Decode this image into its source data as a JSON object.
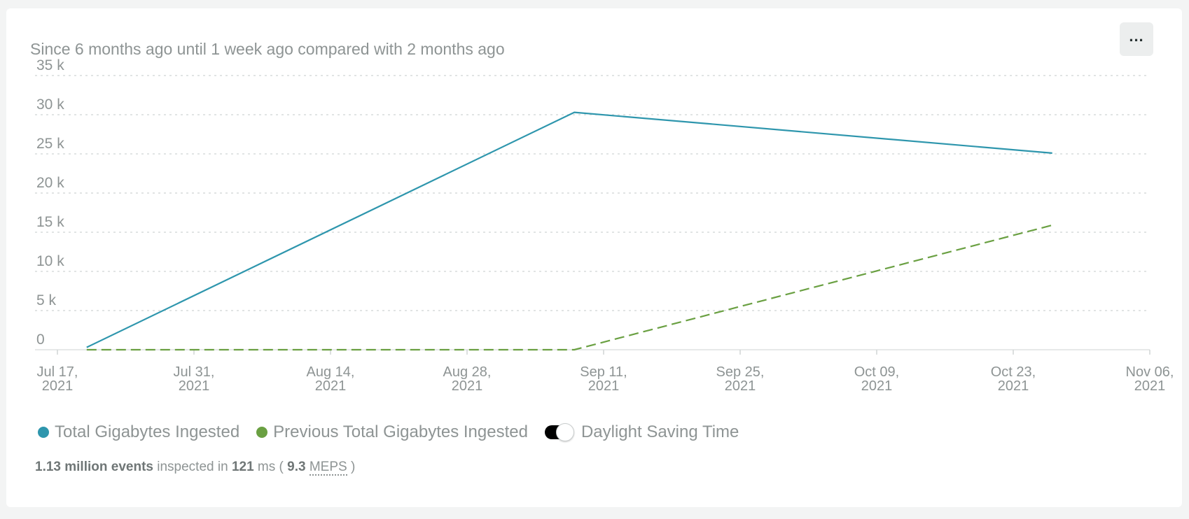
{
  "header": {
    "subtitle": "Since 6 months ago until 1 week ago compared with 2 months ago",
    "menu_label": "..."
  },
  "chart_data": {
    "type": "line",
    "ylim": [
      0,
      35000
    ],
    "y_ticks": [
      {
        "value": 0,
        "label": "0"
      },
      {
        "value": 5000,
        "label": "5 k"
      },
      {
        "value": 10000,
        "label": "10 k"
      },
      {
        "value": 15000,
        "label": "15 k"
      },
      {
        "value": 20000,
        "label": "20 k"
      },
      {
        "value": 25000,
        "label": "25 k"
      },
      {
        "value": 30000,
        "label": "30 k"
      },
      {
        "value": 35000,
        "label": "35 k"
      }
    ],
    "xlim": [
      "2021-07-17",
      "2021-11-06"
    ],
    "x_ticks": [
      {
        "date": "2021-07-17",
        "line1": "Jul 17,",
        "line2": "2021"
      },
      {
        "date": "2021-07-31",
        "line1": "Jul 31,",
        "line2": "2021"
      },
      {
        "date": "2021-08-14",
        "line1": "Aug 14,",
        "line2": "2021"
      },
      {
        "date": "2021-08-28",
        "line1": "Aug 28,",
        "line2": "2021"
      },
      {
        "date": "2021-09-11",
        "line1": "Sep 11,",
        "line2": "2021"
      },
      {
        "date": "2021-09-25",
        "line1": "Sep 25,",
        "line2": "2021"
      },
      {
        "date": "2021-10-09",
        "line1": "Oct 09,",
        "line2": "2021"
      },
      {
        "date": "2021-10-23",
        "line1": "Oct 23,",
        "line2": "2021"
      },
      {
        "date": "2021-11-06",
        "line1": "Nov 06,",
        "line2": "2021"
      }
    ],
    "grid": true,
    "legend_position": "bottom-left",
    "series": [
      {
        "name": "Total Gigabytes Ingested",
        "color": "#2e96ad",
        "style": "solid",
        "points": [
          {
            "date": "2021-07-20",
            "y": 300
          },
          {
            "date": "2021-09-08",
            "y": 30300
          },
          {
            "date": "2021-10-27",
            "y": 25100
          }
        ]
      },
      {
        "name": "Previous Total Gigabytes Ingested",
        "color": "#6aa042",
        "style": "dashed",
        "points": [
          {
            "date": "2021-07-20",
            "y": 0
          },
          {
            "date": "2021-09-08",
            "y": 0
          },
          {
            "date": "2021-10-27",
            "y": 15900
          }
        ]
      }
    ]
  },
  "legend": {
    "toggle_label": "Daylight Saving Time",
    "toggle_on": true
  },
  "footer": {
    "events": "1.13 million events",
    "inspected_in": "inspected in",
    "ms_value": "121",
    "ms_unit": "ms (",
    "meps_value": "9.3",
    "meps_label": "MEPS",
    "close": ")"
  }
}
